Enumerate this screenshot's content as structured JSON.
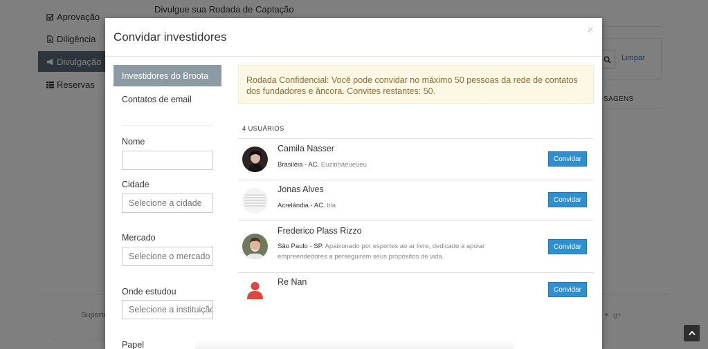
{
  "sidebar": {
    "items": [
      {
        "label": "Aprovação",
        "icon": "check-square-icon"
      },
      {
        "label": "Diligência",
        "icon": "file-icon"
      },
      {
        "label": "Divulgação",
        "icon": "megaphone-icon"
      },
      {
        "label": "Reservas",
        "icon": "list-icon"
      }
    ],
    "active_index": 2
  },
  "background": {
    "page_heading": "Divulgue sua Rodada de Captação",
    "clear_link": "Limpar",
    "messages_tab": "SAGENS",
    "footer_text": "Suporte"
  },
  "modal": {
    "title": "Convidar investidores",
    "close_symbol": "×",
    "tabs": [
      {
        "label": "Investidores do Broota",
        "active": true
      },
      {
        "label": "Contatos de email",
        "active": false
      }
    ],
    "filters": {
      "name_label": "Nome",
      "name_value": "",
      "city_label": "Cidade",
      "city_placeholder": "Selecione a cidade",
      "market_label": "Mercado",
      "market_placeholder": "Selecione o mercado",
      "school_label": "Onde estudou",
      "school_placeholder": "Selecione a instituição",
      "role_label": "Papel"
    },
    "alert_text": "Rodada Confidencial: Você pode convidar no máximo 50 pessoas da rede de contatos dos fundadores e âncora. Convites restantes: 50.",
    "user_count": "4 USUÁRIOS",
    "invite_label": "Convidar",
    "users": [
      {
        "name": "Camila Nasser",
        "location": "Brasiléia - AC.",
        "bio": "Euzinhaeueueu"
      },
      {
        "name": "Jonas Alves",
        "location": "Acrelândia - AC.",
        "bio": "bla"
      },
      {
        "name": "Frederico Plass Rizzo",
        "location": "São Paulo - SP.",
        "bio": "Apaixonado por esportes ao ar livre, dedicado a apoiar empreendedores a perseguirem seus propósitos de vida."
      },
      {
        "name": "Re Nan",
        "location": "",
        "bio": ""
      }
    ]
  },
  "colors": {
    "primary_button": "#2e8fd1",
    "active_tab": "#8c9ba3",
    "alert_bg": "#fcf8e3",
    "alert_text": "#8a6d3b"
  }
}
